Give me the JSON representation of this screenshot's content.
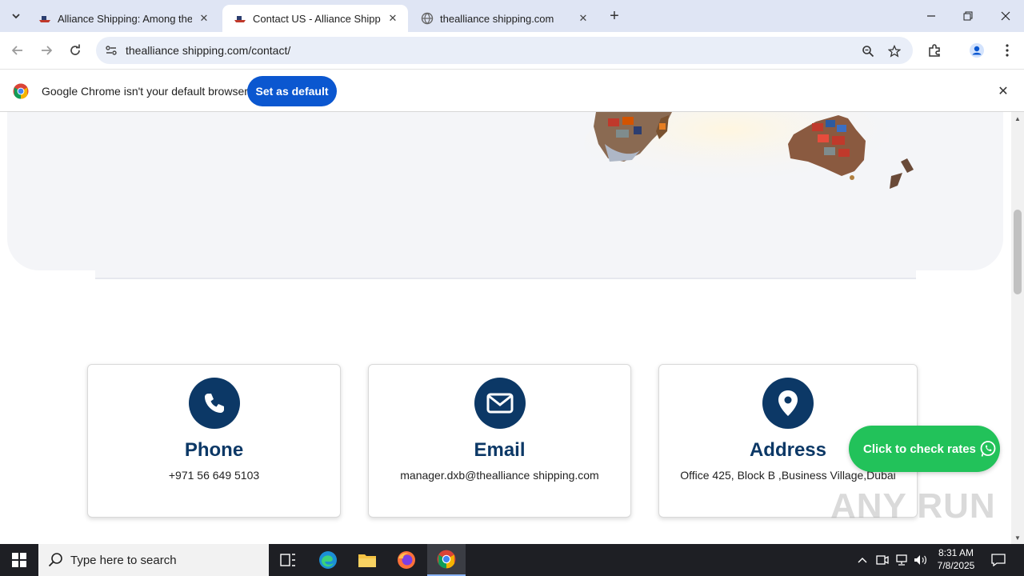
{
  "browser": {
    "tabs": [
      {
        "title": "Alliance Shipping: Among the T",
        "active": false
      },
      {
        "title": "Contact US - Alliance Shipping",
        "active": true
      },
      {
        "title": "thealliance shipping.com",
        "active": false
      }
    ],
    "url": "thealliance shipping.com/contact/",
    "infobar": {
      "message": "Google Chrome isn't your default browser",
      "button": "Set as default"
    }
  },
  "contact_cards": [
    {
      "title": "Phone",
      "text": "+971 56 649 5103",
      "icon": "phone-icon"
    },
    {
      "title": "Email",
      "text": "manager.dxb@thealliance shipping.com",
      "icon": "envelope-icon"
    },
    {
      "title": "Address",
      "text": "Office 425, Block B ,Business Village,Dubai",
      "icon": "map-pin-icon"
    }
  ],
  "floating_button": {
    "label": "Click to check rates"
  },
  "watermark": "ANY RUN",
  "taskbar": {
    "search_placeholder": "Type here to search",
    "time": "8:31 AM",
    "date": "7/8/2025"
  },
  "colors": {
    "brand_navy": "#0c3866",
    "whatsapp_green": "#22c25a",
    "chrome_blue": "#0b57d0"
  }
}
